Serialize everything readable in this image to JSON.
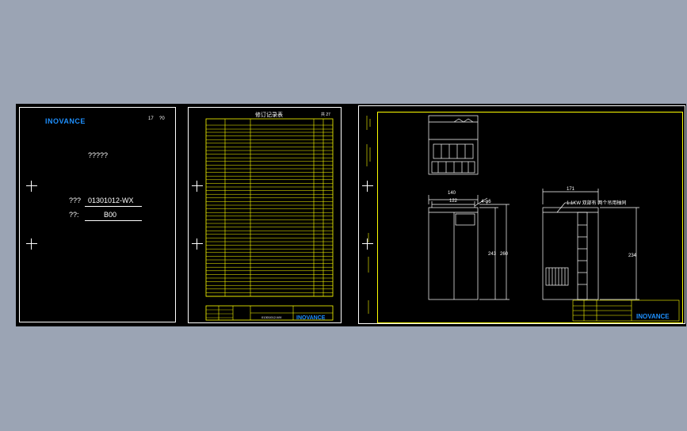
{
  "cover": {
    "logo": "INOVANCE",
    "corner_a": "17",
    "corner_b": "?0",
    "title": "?????",
    "line1_label": "???",
    "line1_value": "01301012-WX",
    "line2_label": "??:",
    "line2_value": "B00"
  },
  "revision": {
    "title": "修订记录表",
    "corner": "共 27",
    "footer_code": "01301012-WX",
    "logo": "INOVANCE"
  },
  "drawing": {
    "dim_140": "140",
    "dim_122": "122",
    "hole": "4-φ6",
    "dim_243": "243",
    "dim_260": "260",
    "dim_171": "171",
    "note": "1.1KW 双部有 两个吊用柚同",
    "dim_234": "234",
    "logo": "INOVANCE"
  },
  "colors": {
    "background": "#9ba4b4",
    "canvas": "#000000",
    "line": "#ffffff",
    "frame": "#ffff00",
    "brand": "#1e90ff"
  }
}
